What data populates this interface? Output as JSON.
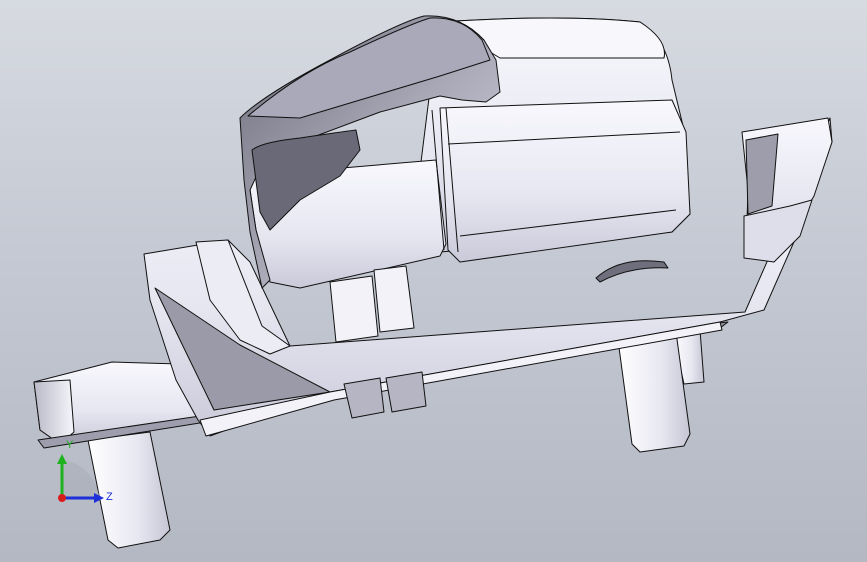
{
  "viewport": {
    "background_top": "#d7dae1",
    "background_bottom": "#b3b8c3"
  },
  "model": {
    "body_fill_light": "#f4f4fb",
    "body_fill_mid": "#dcdcea",
    "shadow_fill": "#8a8a98",
    "edge_color": "#111111"
  },
  "triad": {
    "y_label": "Y",
    "z_label": "Z",
    "y_color": "#1db31d",
    "z_color": "#1c2fd8",
    "x_color": "#d81c1c"
  }
}
